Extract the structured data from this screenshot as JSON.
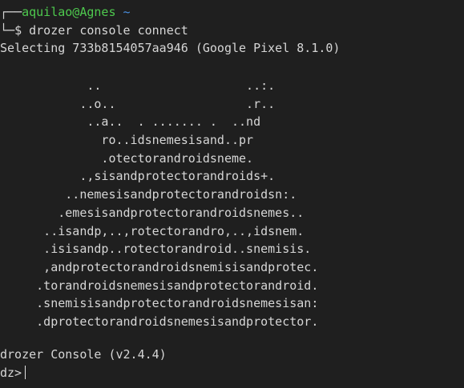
{
  "prompt": {
    "box_top": "┌──",
    "user_host": "aquilao@Agnes",
    "cwd": "~",
    "box_bottom": "└─",
    "symbol": "$",
    "command": "drozer console connect"
  },
  "status_line": "Selecting 733b8154057aa946 (Google Pixel 8.1.0)",
  "banner": [
    "            ..                    ..:.",
    "           ..o..                  .r..",
    "            ..a..  . ....... .  ..nd",
    "              ro..idsnemesisand..pr",
    "              .otectorandroidsneme.",
    "           .,sisandprotectorandroids+.",
    "         ..nemesisandprotectorandroidsn:.",
    "        .emesisandprotectorandroidsnemes..",
    "      ..isandp,..,rotectorandro,..,idsnem.",
    "      .isisandp..rotectorandroid..snemisis.",
    "      ,andprotectorandroidsnemisisandprotec.",
    "     .torandroidsnemesisandprotectorandroid.",
    "     .snemisisandprotectorandroidsnemesisan:",
    "     .dprotectorandroidsnemesisandprotector."
  ],
  "console_version": "drozer Console (v2.4.4)",
  "console_prompt": "dz>"
}
